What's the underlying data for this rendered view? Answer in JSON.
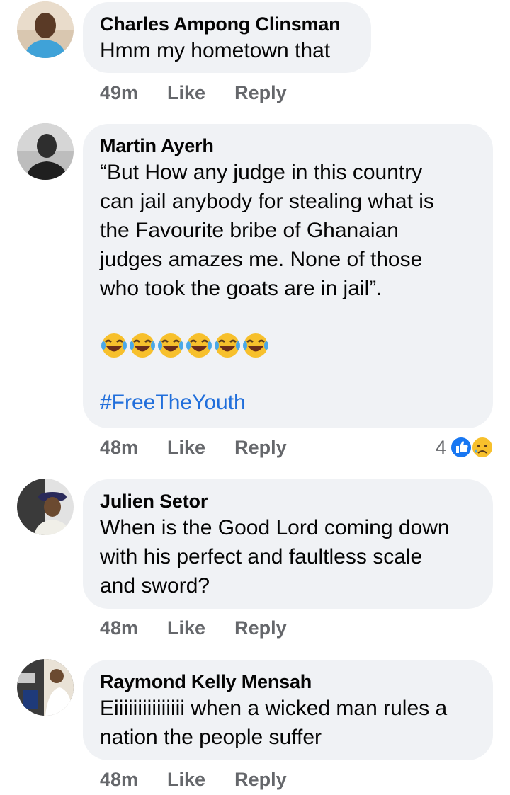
{
  "comments": [
    {
      "author": "Charles Ampong Clinsman",
      "text": "Hmm my hometown that",
      "time": "49m",
      "like_label": "Like",
      "reply_label": "Reply"
    },
    {
      "author": "Martin Ayerh",
      "text_lines": [
        "“But How any judge in this country",
        "can jail anybody for stealing what is",
        "the Favourite bribe of Ghanaian",
        "judges amazes me. None of those",
        "who took the goats are in jail”."
      ],
      "emojis": [
        "joy-emoji",
        "joy-emoji",
        "joy-emoji",
        "joy-emoji",
        "joy-emoji",
        "joy-emoji"
      ],
      "hashtag": "#FreeTheYouth",
      "time": "48m",
      "like_label": "Like",
      "reply_label": "Reply",
      "reactions": {
        "count": "4",
        "icons": [
          "like-reaction-icon",
          "sad-reaction-icon"
        ],
        "like_color": "#1877f2"
      }
    },
    {
      "author": "Julien Setor",
      "text_lines": [
        "When is the Good Lord coming down",
        "with his perfect and faultless scale",
        "and sword?"
      ],
      "time": "48m",
      "like_label": "Like",
      "reply_label": "Reply"
    },
    {
      "author": "Raymond Kelly Mensah",
      "text_lines": [
        "Eiiiiiiiiiiiiiii when a wicked man rules a",
        "nation the people suffer"
      ],
      "time": "48m",
      "like_label": "Like",
      "reply_label": "Reply"
    }
  ],
  "colors": {
    "bubble": "#f0f2f5",
    "meta": "#65676b",
    "hashtag": "#216fdb",
    "text": "#050505"
  }
}
